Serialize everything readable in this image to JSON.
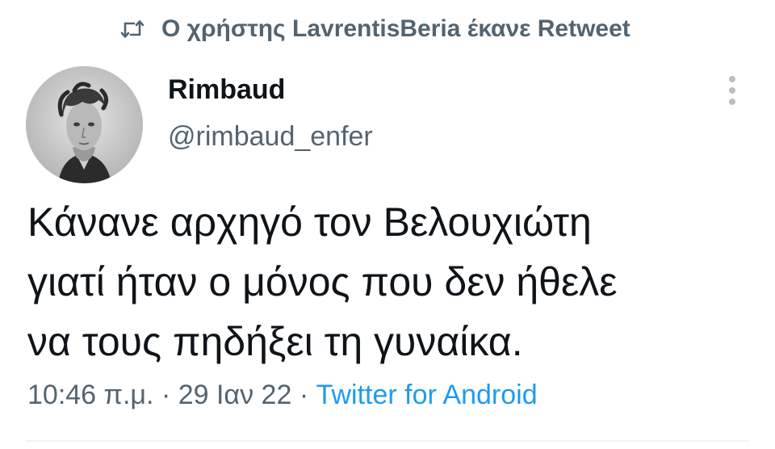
{
  "retweet_banner": {
    "icon": "retweet-icon",
    "text": "Ο χρήστης LavrentisBeria έκανε Retweet"
  },
  "author": {
    "avatar": "portrait-photo",
    "display_name": "Rimbaud",
    "handle": "@rimbaud_enfer"
  },
  "more_menu": {
    "icon": "more-vertical-icon"
  },
  "tweet": {
    "lines": [
      "Κάνανε αρχηγό τον Βελουχιώτη",
      "γιατί ήταν ο μόνος που δεν ήθελε",
      "να τους πηδήξει τη γυναίκα."
    ],
    "time": "10:46 π.μ.",
    "separator": "·",
    "date": "29 Ιαν 22",
    "source": "Twitter for Android"
  },
  "colors": {
    "text": "#0f1419",
    "secondary": "#536471",
    "link": "#1d9bf0"
  }
}
